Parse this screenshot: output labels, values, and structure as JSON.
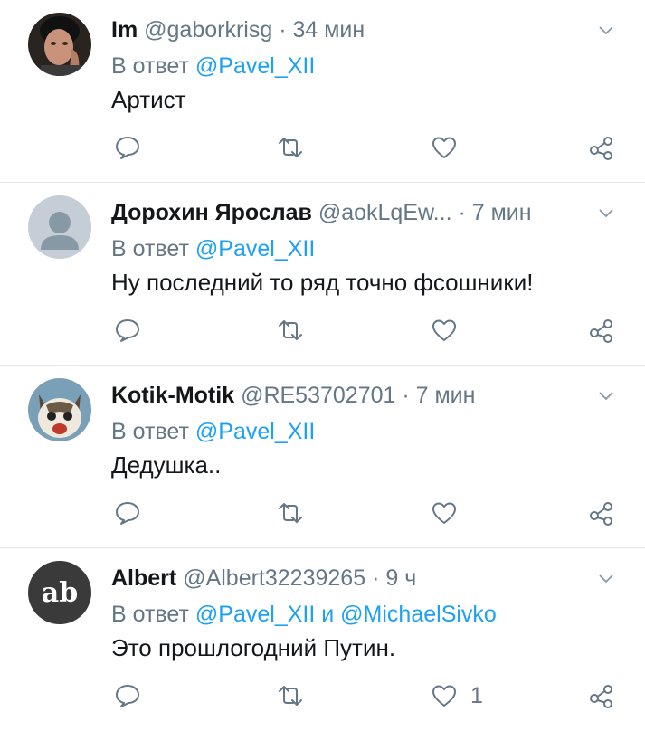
{
  "colors": {
    "accent": "#1da1f2",
    "muted": "#657786",
    "text": "#14171a",
    "divider": "#e3e8ec"
  },
  "reply_prefix": "В ответ",
  "tweets": [
    {
      "name": "Im",
      "handle": "@gaborkrisg",
      "time": "34 мин",
      "mentions": [
        "@Pavel_XII"
      ],
      "text": "Артист",
      "likes": ""
    },
    {
      "name": "Дорохин Ярослав",
      "handle": "@aokLqEw...",
      "time": "7 мин",
      "mentions": [
        "@Pavel_XII"
      ],
      "text": "Ну последний то ряд точно фсошники!",
      "likes": ""
    },
    {
      "name": "Kotik-Motik",
      "handle": "@RE53702701",
      "time": "7 мин",
      "mentions": [
        "@Pavel_XII"
      ],
      "text": "Дедушка..",
      "likes": ""
    },
    {
      "name": "Albert",
      "handle": "@Albert32239265",
      "time": "9 ч",
      "mentions": [
        "@Pavel_XII",
        "@MichaelSivko"
      ],
      "mention_joiner": "и",
      "text": "Это прошлогодний Путин.",
      "likes": "1"
    }
  ],
  "avatars": [
    "photo-avatar",
    "default-avatar",
    "cat-avatar",
    "ab-logo-avatar"
  ],
  "logo_text": "ab",
  "dot": "·"
}
